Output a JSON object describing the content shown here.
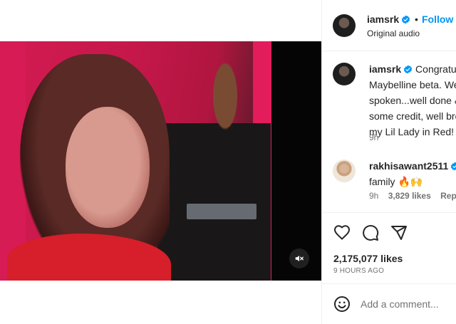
{
  "post": {
    "author": "iamsrk",
    "audio": "Original audio",
    "follow_label": "Follow",
    "separator": "•"
  },
  "comments": [
    {
      "user": "iamsrk",
      "lines": [
        "Congratul",
        "Maybelline beta. We",
        "spoken...well done &",
        "some credit, well bro",
        "my Lil Lady in Red!"
      ],
      "time": "9h"
    },
    {
      "user": "rakhisawant2511",
      "lines": [
        "family 🔥🙌"
      ],
      "time": "9h",
      "likes": "3,829 likes",
      "reply_label": "Reply"
    }
  ],
  "actions": {
    "like_icon": "heart-icon",
    "comment_icon": "comment-icon",
    "share_icon": "share-icon"
  },
  "likes_text": "2,175,077 likes",
  "time_ago": "9 HOURS AGO",
  "add_comment": {
    "placeholder": "Add a comment...",
    "emoji_icon": "emoji-icon"
  },
  "video": {
    "mute_icon": "speaker-muted-icon"
  },
  "colors": {
    "accent": "#0095f6",
    "verified": "#0095f6",
    "text": "#262626",
    "muted": "#737373"
  }
}
